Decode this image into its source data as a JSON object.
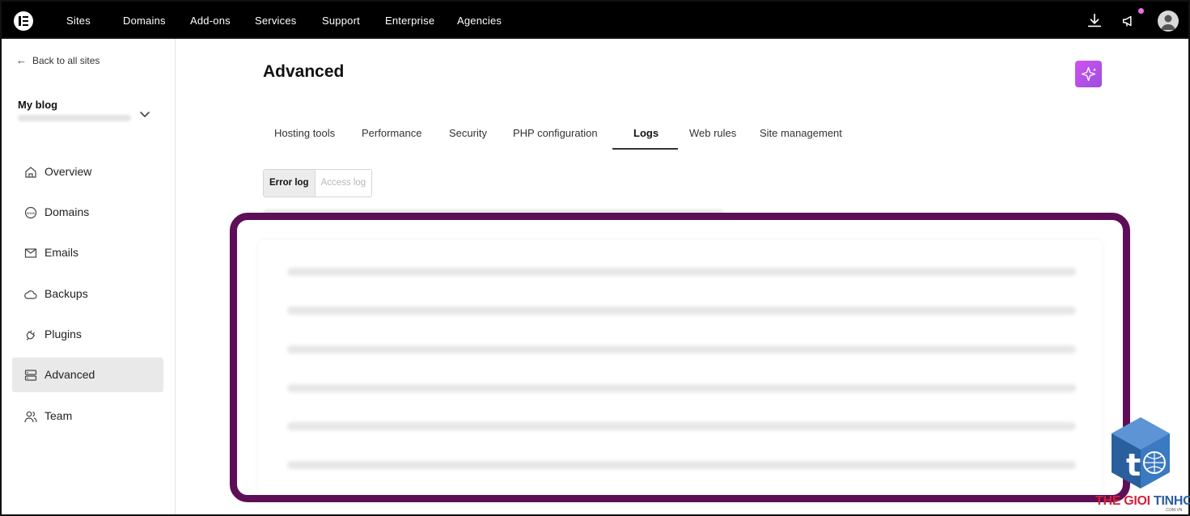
{
  "topbar": {
    "nav": [
      "Sites",
      "Domains",
      "Add-ons",
      "Services",
      "Support",
      "Enterprise",
      "Agencies"
    ],
    "icons": [
      "download-icon",
      "megaphone-icon",
      "user-avatar-icon"
    ],
    "notification_dot_color": "#e96ee9"
  },
  "sidebar": {
    "back_label": "Back to all sites",
    "site_name": "My blog",
    "items": [
      {
        "label": "Overview",
        "icon": "home-icon"
      },
      {
        "label": "Domains",
        "icon": "www-globe-icon"
      },
      {
        "label": "Emails",
        "icon": "envelope-icon"
      },
      {
        "label": "Backups",
        "icon": "cloud-icon"
      },
      {
        "label": "Plugins",
        "icon": "plug-icon"
      },
      {
        "label": "Advanced",
        "icon": "server-icon",
        "active": true
      },
      {
        "label": "Team",
        "icon": "users-icon"
      }
    ]
  },
  "main": {
    "title": "Advanced",
    "tabs": [
      "Hosting tools",
      "Performance",
      "Security",
      "PHP configuration",
      "Logs",
      "Web rules",
      "Site management"
    ],
    "active_tab": "Logs",
    "log_toggle": {
      "error_label": "Error log",
      "access_label": "Access log",
      "selected": "Error log"
    },
    "highlight_color": "#5e0e57",
    "ai_button_colors": [
      "#d052f0",
      "#9b4ee0"
    ]
  },
  "watermark": {
    "brand_red": "THE GIOI",
    "brand_blue": "TINHOC",
    "domain": ".COM.VN"
  }
}
